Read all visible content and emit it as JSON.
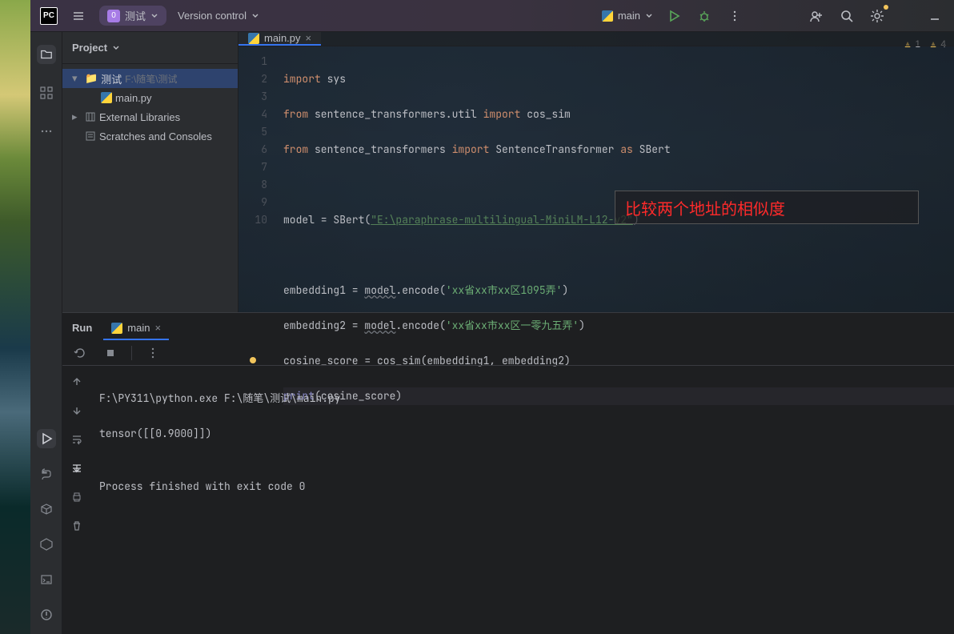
{
  "titlebar": {
    "logo": "PC",
    "project_name": "测试",
    "version_control": "Version control",
    "run_config": "main",
    "icons": {
      "menu": "menu-icon",
      "chevron_down": "chevron-down-icon",
      "play": "play-icon",
      "debug": "bug-icon",
      "more": "more-vertical-icon",
      "share": "code-collab-icon",
      "search": "search-icon",
      "settings": "gear-icon",
      "minimize": "minimize-icon"
    }
  },
  "project_tree": {
    "header": "Project",
    "root": {
      "name": "测试",
      "path": "F:\\随笔\\测试"
    },
    "file": "main.py",
    "external": "External Libraries",
    "scratches": "Scratches and Consoles"
  },
  "editor": {
    "tab": "main.py",
    "inspection": {
      "warn": "1",
      "weak": "4"
    },
    "lines": [
      {
        "n": "1"
      },
      {
        "n": "2"
      },
      {
        "n": "3"
      },
      {
        "n": "4"
      },
      {
        "n": "5"
      },
      {
        "n": "6"
      },
      {
        "n": "7"
      },
      {
        "n": "8"
      },
      {
        "n": "9"
      },
      {
        "n": "10"
      }
    ],
    "code": {
      "l1_kw": "import",
      "l1_rest": " sys",
      "l2_from": "from",
      "l2_mod": " sentence_transformers.util ",
      "l2_imp": "import",
      "l2_name": " cos_sim",
      "l3_from": "from",
      "l3_mod": " sentence_transformers ",
      "l3_imp": "import",
      "l3_name": " SentenceTransformer ",
      "l3_as": "as",
      "l3_alias": " SBert",
      "l5_a": "model = SBert(",
      "l5_str": "\"E:\\paraphrase-multilingual-MiniLM-L12-v2\"",
      "l5_b": ")",
      "l7_a": "embedding1 = ",
      "l7_u": "model",
      "l7_b": ".encode(",
      "l7_str": "'xx省xx市xx区1095弄'",
      "l7_c": ")",
      "l8_a": "embedding2 = ",
      "l8_u": "model",
      "l8_b": ".encode(",
      "l8_str": "'xx省xx市xx区一零九五弄'",
      "l8_c": ")",
      "l9": "cosine_score = cos_sim(embedding1, embedding2)",
      "l10_a": "print",
      "l10_b": "(cosine_score)"
    },
    "annotation": "比较两个地址的相似度"
  },
  "run": {
    "label": "Run",
    "tab": "main",
    "output_l1": "F:\\PY311\\python.exe F:\\随笔\\测试\\main.py",
    "output_l2": "tensor([[0.9000]])",
    "output_l3": "",
    "output_l4": "Process finished with exit code 0"
  }
}
